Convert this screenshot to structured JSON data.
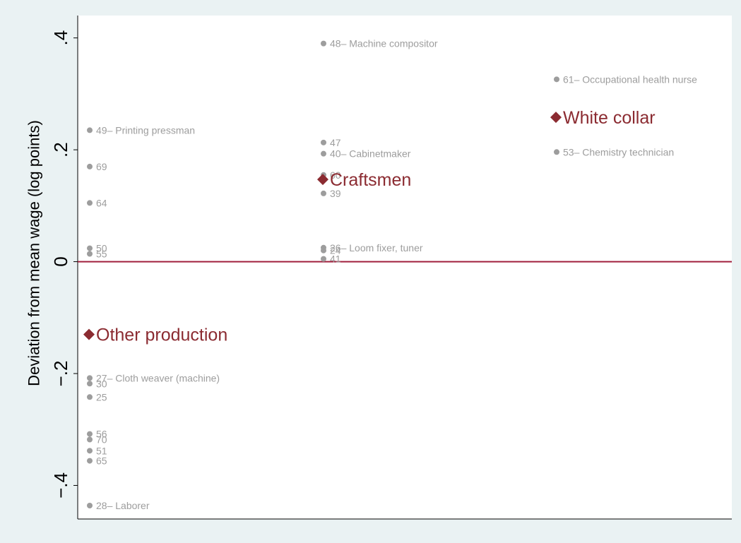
{
  "chart_data": {
    "type": "scatter",
    "title": "",
    "xlabel": "",
    "ylabel": "Deviation from mean wage (log points)",
    "ylim": [
      -0.46,
      0.44
    ],
    "yticks": [
      0.4,
      0.2,
      0,
      -0.2,
      -0.4
    ],
    "ytick_labels": [
      ".4",
      ".2",
      "0",
      "-.2",
      "-.4"
    ],
    "categories": [
      "Other production",
      "Craftsmen",
      "White collar"
    ],
    "reference_line": {
      "y": 0,
      "color": "#a01e3c"
    },
    "grid": true,
    "colors": {
      "point": "#9d9d9d",
      "group": "#8b2b31",
      "background": "#eaf2f3",
      "plot_background": "#ffffff"
    },
    "series": [
      {
        "category": "Other production",
        "mean": -0.13,
        "points": [
          {
            "label": "49– Printing pressman",
            "y": 0.235
          },
          {
            "label": "69",
            "y": 0.17
          },
          {
            "label": "64",
            "y": 0.105
          },
          {
            "label": "50",
            "y": 0.024
          },
          {
            "label": "55",
            "y": 0.014
          },
          {
            "label": "27– Cloth weaver (machine)",
            "y": -0.208
          },
          {
            "label": "30",
            "y": -0.218
          },
          {
            "label": "25",
            "y": -0.242
          },
          {
            "label": "56",
            "y": -0.308
          },
          {
            "label": "70",
            "y": -0.318
          },
          {
            "label": "51",
            "y": -0.338
          },
          {
            "label": "65",
            "y": -0.356
          },
          {
            "label": "28– Laborer",
            "y": -0.436
          }
        ]
      },
      {
        "category": "Craftsmen",
        "mean": 0.147,
        "points": [
          {
            "label": "48– Machine compositor",
            "y": 0.39
          },
          {
            "label": "47",
            "y": 0.213
          },
          {
            "label": "40– Cabinetmaker",
            "y": 0.193
          },
          {
            "label": "60",
            "y": 0.155
          },
          {
            "label": "39",
            "y": 0.122
          },
          {
            "label": "26– Loom fixer, tuner",
            "y": 0.025
          },
          {
            "label": "24",
            "y": 0.02
          },
          {
            "label": "41",
            "y": 0.005
          }
        ]
      },
      {
        "category": "White collar",
        "mean": 0.258,
        "points": [
          {
            "label": "61– Occupational health nurse",
            "y": 0.326
          },
          {
            "label": "53– Chemistry technician",
            "y": 0.196
          }
        ]
      }
    ]
  }
}
